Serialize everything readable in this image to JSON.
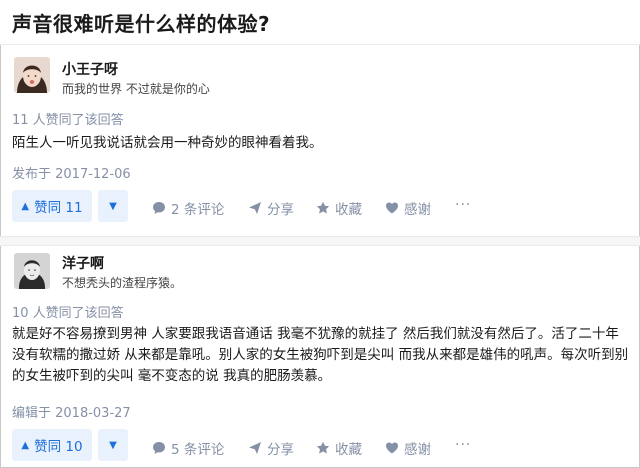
{
  "question": {
    "title": "声音很难听是什么样的体验?"
  },
  "answers": [
    {
      "author_name": "小王子呀",
      "author_bio": "而我的世界 不过就是你的心",
      "vote_summary": "11 人赞同了该回答",
      "content": "陌生人一听见我说话就会用一种奇妙的眼神看着我。",
      "date": "发布于 2017-12-06",
      "vote_label": "赞同 11",
      "comments_label": "2 条评论",
      "share_label": "分享",
      "favorite_label": "收藏",
      "thanks_label": "感谢",
      "more_label": "···"
    },
    {
      "author_name": "洋子啊",
      "author_bio": "不想秃头的渣程序猿。",
      "vote_summary": "10 人赞同了该回答",
      "content": "就是好不容易撩到男神 人家要跟我语音通话 我毫不犹豫的就挂了 然后我们就没有然后了。活了二十年 没有软糯的撒过娇 从来都是靠吼。别人家的女生被狗吓到是尖叫 而我从来都是雄伟的吼声。每次听到别的女生被吓到的尖叫 毫不变态的说 我真的肥肠羡慕。",
      "date": "编辑于 2018-03-27",
      "vote_label": "赞同 10",
      "comments_label": "5 条评论",
      "share_label": "分享",
      "favorite_label": "收藏",
      "thanks_label": "感谢",
      "more_label": "···"
    }
  ],
  "icons": {
    "vote_up": "triangle-up-icon",
    "vote_down": "triangle-down-icon",
    "comment": "comment-bubble-icon",
    "share": "paper-plane-icon",
    "favorite": "star-icon",
    "thanks": "heart-icon"
  },
  "colors": {
    "accent": "#1e6fd9",
    "accent_bg": "#e9f1fc",
    "muted": "#8590a6"
  }
}
